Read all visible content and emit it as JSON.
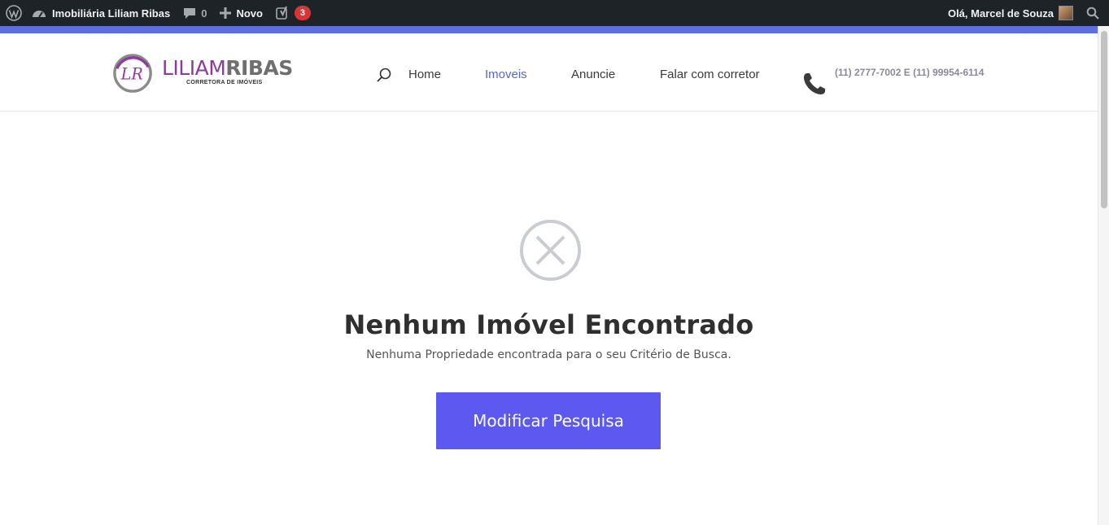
{
  "adminbar": {
    "site_name": "Imobiliária Liliam Ribas",
    "comments_count": "0",
    "new_label": "Novo",
    "yoast_badge": "3",
    "greeting": "Olá, Marcel de Souza"
  },
  "header": {
    "logo": {
      "first": "LILIAM",
      "last": "RIBAS",
      "tagline": "CORRETORA DE IMÓVEIS",
      "monogram": "LR"
    },
    "nav": [
      {
        "label": "Home"
      },
      {
        "label": "Imoveis",
        "active": true
      },
      {
        "label": "Anuncie"
      },
      {
        "label": "Falar com corretor"
      }
    ],
    "phone": "(11) 2777-7002 E (11) 99954-6114"
  },
  "main": {
    "title": "Nenhum Imóvel Encontrado",
    "subtitle": "Nenhuma Propriedade encontrada para o seu Critério de Busca.",
    "button_label": "Modificar Pesquisa"
  },
  "colors": {
    "accent": "#5e6ee0",
    "nav_active": "#5468d4",
    "button": "#5c58f0",
    "adminbar": "#1d2327",
    "brand_purple": "#8e3a9e"
  },
  "icons": [
    "wordpress-icon",
    "dashboard-icon",
    "comment-icon",
    "plus-icon",
    "yoast-icon",
    "avatar",
    "search-icon",
    "phone-icon",
    "x-circle-icon"
  ]
}
